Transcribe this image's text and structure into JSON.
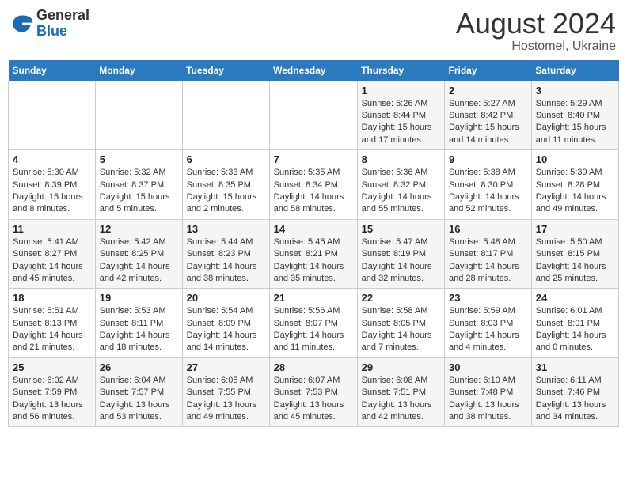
{
  "header": {
    "logo_general": "General",
    "logo_blue": "Blue",
    "main_title": "August 2024",
    "sub_title": "Hostomel, Ukraine"
  },
  "days_of_week": [
    "Sunday",
    "Monday",
    "Tuesday",
    "Wednesday",
    "Thursday",
    "Friday",
    "Saturday"
  ],
  "weeks": [
    [
      {
        "day": "",
        "info": ""
      },
      {
        "day": "",
        "info": ""
      },
      {
        "day": "",
        "info": ""
      },
      {
        "day": "",
        "info": ""
      },
      {
        "day": "1",
        "info": "Sunrise: 5:26 AM\nSunset: 8:44 PM\nDaylight: 15 hours and 17 minutes."
      },
      {
        "day": "2",
        "info": "Sunrise: 5:27 AM\nSunset: 8:42 PM\nDaylight: 15 hours and 14 minutes."
      },
      {
        "day": "3",
        "info": "Sunrise: 5:29 AM\nSunset: 8:40 PM\nDaylight: 15 hours and 11 minutes."
      }
    ],
    [
      {
        "day": "4",
        "info": "Sunrise: 5:30 AM\nSunset: 8:39 PM\nDaylight: 15 hours and 8 minutes."
      },
      {
        "day": "5",
        "info": "Sunrise: 5:32 AM\nSunset: 8:37 PM\nDaylight: 15 hours and 5 minutes."
      },
      {
        "day": "6",
        "info": "Sunrise: 5:33 AM\nSunset: 8:35 PM\nDaylight: 15 hours and 2 minutes."
      },
      {
        "day": "7",
        "info": "Sunrise: 5:35 AM\nSunset: 8:34 PM\nDaylight: 14 hours and 58 minutes."
      },
      {
        "day": "8",
        "info": "Sunrise: 5:36 AM\nSunset: 8:32 PM\nDaylight: 14 hours and 55 minutes."
      },
      {
        "day": "9",
        "info": "Sunrise: 5:38 AM\nSunset: 8:30 PM\nDaylight: 14 hours and 52 minutes."
      },
      {
        "day": "10",
        "info": "Sunrise: 5:39 AM\nSunset: 8:28 PM\nDaylight: 14 hours and 49 minutes."
      }
    ],
    [
      {
        "day": "11",
        "info": "Sunrise: 5:41 AM\nSunset: 8:27 PM\nDaylight: 14 hours and 45 minutes."
      },
      {
        "day": "12",
        "info": "Sunrise: 5:42 AM\nSunset: 8:25 PM\nDaylight: 14 hours and 42 minutes."
      },
      {
        "day": "13",
        "info": "Sunrise: 5:44 AM\nSunset: 8:23 PM\nDaylight: 14 hours and 38 minutes."
      },
      {
        "day": "14",
        "info": "Sunrise: 5:45 AM\nSunset: 8:21 PM\nDaylight: 14 hours and 35 minutes."
      },
      {
        "day": "15",
        "info": "Sunrise: 5:47 AM\nSunset: 8:19 PM\nDaylight: 14 hours and 32 minutes."
      },
      {
        "day": "16",
        "info": "Sunrise: 5:48 AM\nSunset: 8:17 PM\nDaylight: 14 hours and 28 minutes."
      },
      {
        "day": "17",
        "info": "Sunrise: 5:50 AM\nSunset: 8:15 PM\nDaylight: 14 hours and 25 minutes."
      }
    ],
    [
      {
        "day": "18",
        "info": "Sunrise: 5:51 AM\nSunset: 8:13 PM\nDaylight: 14 hours and 21 minutes."
      },
      {
        "day": "19",
        "info": "Sunrise: 5:53 AM\nSunset: 8:11 PM\nDaylight: 14 hours and 18 minutes."
      },
      {
        "day": "20",
        "info": "Sunrise: 5:54 AM\nSunset: 8:09 PM\nDaylight: 14 hours and 14 minutes."
      },
      {
        "day": "21",
        "info": "Sunrise: 5:56 AM\nSunset: 8:07 PM\nDaylight: 14 hours and 11 minutes."
      },
      {
        "day": "22",
        "info": "Sunrise: 5:58 AM\nSunset: 8:05 PM\nDaylight: 14 hours and 7 minutes."
      },
      {
        "day": "23",
        "info": "Sunrise: 5:59 AM\nSunset: 8:03 PM\nDaylight: 14 hours and 4 minutes."
      },
      {
        "day": "24",
        "info": "Sunrise: 6:01 AM\nSunset: 8:01 PM\nDaylight: 14 hours and 0 minutes."
      }
    ],
    [
      {
        "day": "25",
        "info": "Sunrise: 6:02 AM\nSunset: 7:59 PM\nDaylight: 13 hours and 56 minutes."
      },
      {
        "day": "26",
        "info": "Sunrise: 6:04 AM\nSunset: 7:57 PM\nDaylight: 13 hours and 53 minutes."
      },
      {
        "day": "27",
        "info": "Sunrise: 6:05 AM\nSunset: 7:55 PM\nDaylight: 13 hours and 49 minutes."
      },
      {
        "day": "28",
        "info": "Sunrise: 6:07 AM\nSunset: 7:53 PM\nDaylight: 13 hours and 45 minutes."
      },
      {
        "day": "29",
        "info": "Sunrise: 6:08 AM\nSunset: 7:51 PM\nDaylight: 13 hours and 42 minutes."
      },
      {
        "day": "30",
        "info": "Sunrise: 6:10 AM\nSunset: 7:48 PM\nDaylight: 13 hours and 38 minutes."
      },
      {
        "day": "31",
        "info": "Sunrise: 6:11 AM\nSunset: 7:46 PM\nDaylight: 13 hours and 34 minutes."
      }
    ]
  ]
}
